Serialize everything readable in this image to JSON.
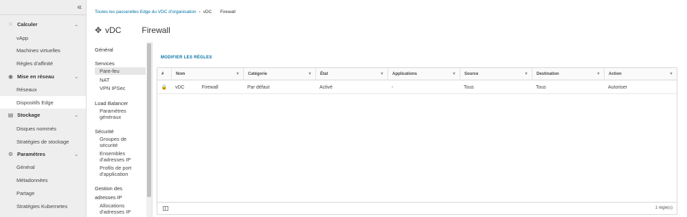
{
  "nav": {
    "collapse_icon": "«",
    "sections": [
      {
        "label": "Calculer",
        "icon": "grid-icon",
        "glyph": "⁙",
        "items": [
          "vApp",
          "Machines virtuelles",
          "Règles d'affinité"
        ]
      },
      {
        "label": "Mise en réseau",
        "icon": "network-icon",
        "glyph": "◉",
        "items": [
          "Réseaux",
          "Dispositifs Edge"
        ]
      },
      {
        "label": "Stockage",
        "icon": "storage-icon",
        "glyph": "▤",
        "items": [
          "Disques nommés",
          "Stratégies de stockage"
        ]
      },
      {
        "label": "Paramètres",
        "icon": "gear-icon",
        "glyph": "⚙",
        "items": [
          "Général",
          "Métadonnées",
          "Partage",
          "Stratégies Kubernetes"
        ]
      }
    ],
    "active_item": "Dispositifs Edge"
  },
  "breadcrumb": {
    "link": "Toutes les passerelles Edge du VDC d'organisation",
    "sep": "›",
    "vdc": "vDC",
    "current": "Firewall"
  },
  "title": {
    "prefix": "vDC",
    "name": "Firewall",
    "icon": "move-icon"
  },
  "tree": {
    "general": "Général",
    "services": "Services",
    "services_items": [
      "Pare-feu",
      "NAT",
      "VPN IPSec"
    ],
    "load_balancer": "Load Balancer",
    "lb_items": [
      "Paramètres généraux"
    ],
    "security": "Sécurité",
    "security_items": [
      "Groupes de sécurité",
      "Ensembles d'adresses IP",
      "Profils de port d'application"
    ],
    "ip_management_1": "Gestion des",
    "ip_management_2": "adresses IP",
    "ip_items": [
      "Allocations d'adresses IP"
    ]
  },
  "actions": {
    "modify_rules": "MODIFIER LES RÈGLES"
  },
  "grid": {
    "columns": [
      "#",
      "Nom",
      "Catégorie",
      "État",
      "Applications",
      "Source",
      "Destination",
      "Action"
    ],
    "filter_icon": "▼",
    "rows": [
      {
        "lock": "🔒",
        "name_a": "vDC",
        "name_b": "Firewall",
        "category": "Par défaut",
        "state": "Activé",
        "applications": "-",
        "source": "Tous",
        "destination": "Tous",
        "action": "Autoriser"
      }
    ],
    "footer_count": "1 règle(s)"
  }
}
